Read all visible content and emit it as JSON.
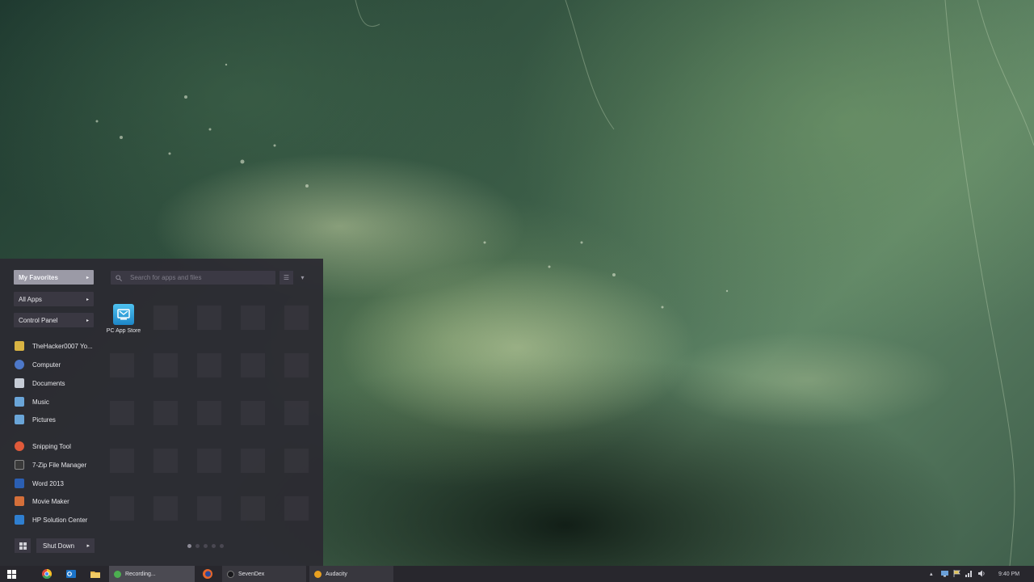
{
  "start_menu": {
    "categories": [
      {
        "label": "My Favorites",
        "active": true
      },
      {
        "label": "All Apps",
        "active": false
      },
      {
        "label": "Control Panel",
        "active": false
      }
    ],
    "search_placeholder": "Search for apps and files",
    "pinned": [
      {
        "label": "TheHacker0007 Yo...",
        "icon": "user-folder-icon",
        "color": "#d9b443"
      },
      {
        "label": "Computer",
        "icon": "computer-icon",
        "color": "#4d78c9"
      },
      {
        "label": "Documents",
        "icon": "documents-icon",
        "color": "#c6ccd6"
      },
      {
        "label": "Music",
        "icon": "music-icon",
        "color": "#6aa5d8"
      },
      {
        "label": "Pictures",
        "icon": "pictures-icon",
        "color": "#6aa5d8"
      },
      {
        "label": "Snipping Tool",
        "icon": "scissors-icon",
        "color": "#e05a3a"
      },
      {
        "label": "7-Zip File Manager",
        "icon": "7zip-icon",
        "color": "#3a3a3a"
      },
      {
        "label": "Word 2013",
        "icon": "word-icon",
        "color": "#2b5fb3"
      },
      {
        "label": "Movie Maker",
        "icon": "movie-maker-icon",
        "color": "#d46f3a"
      },
      {
        "label": "HP Solution Center",
        "icon": "hp-icon",
        "color": "#2f7fd0"
      }
    ],
    "tiles": [
      {
        "label": "PC App Store",
        "icon": "pc-app-store-icon"
      }
    ],
    "shutdown_label": "Shut Down"
  },
  "taskbar": {
    "tasks": [
      {
        "label": "Recording...",
        "icon": "recorder-icon",
        "color": "#4caf50",
        "active": true
      },
      {
        "label": "SevenDex",
        "icon": "sevendex-icon",
        "color": "#2a2a30",
        "active": false
      },
      {
        "label": "Audacity",
        "icon": "audacity-icon",
        "color": "#e8a020",
        "active": false
      }
    ],
    "pinned_icons": [
      "chrome-icon",
      "outlook-icon",
      "file-explorer-icon",
      "firefox-icon"
    ],
    "clock": "9:40 PM"
  },
  "colors": {
    "accent": "#1d86c7",
    "menu_bg": "#2c2a32",
    "taskbar_bg": "#28272d"
  }
}
